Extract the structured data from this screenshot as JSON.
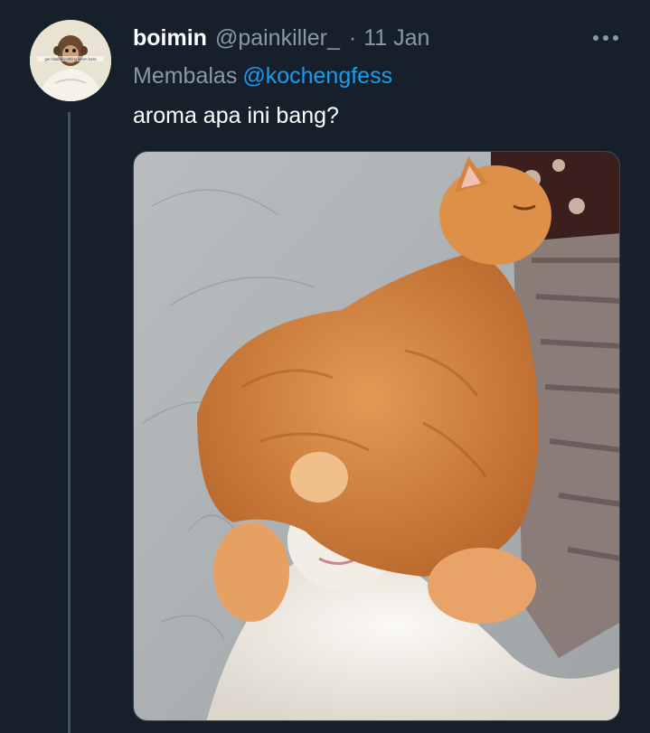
{
  "tweet": {
    "display_name": "boimin",
    "handle": "@painkiller_",
    "separator": "·",
    "date": "11 Jan",
    "reply_label": "Membalas",
    "reply_mention": "@kochengfess",
    "text": "aroma apa ini bang?",
    "more_icon": "more-horizontal-icon",
    "avatar_caption": "get hittable nothing lorem boss"
  },
  "colors": {
    "background": "#15202b",
    "primary_text": "#ffffff",
    "secondary_text": "#8b98a5",
    "link": "#1d9bf0",
    "thread_line": "#3d5466",
    "media_border": "#38444d"
  }
}
